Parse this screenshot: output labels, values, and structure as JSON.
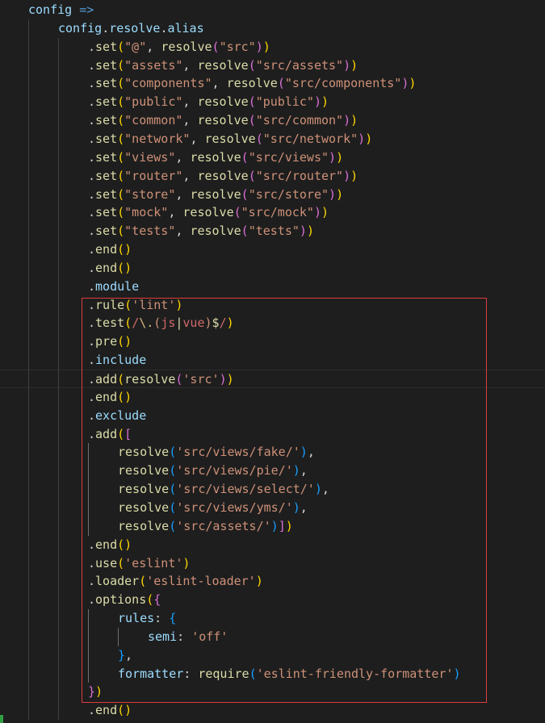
{
  "editor": {
    "lines": [
      {
        "indent": 0,
        "tokens": [
          [
            "config",
            "#9cdcfe"
          ],
          [
            " =>",
            "#569cd6"
          ]
        ]
      },
      {
        "indent": 1,
        "tokens": [
          [
            "config",
            "#9cdcfe"
          ],
          [
            ".",
            "#d4d4d4"
          ],
          [
            "resolve",
            "#9cdcfe"
          ],
          [
            ".",
            "#d4d4d4"
          ],
          [
            "alias",
            "#9cdcfe"
          ]
        ]
      },
      {
        "indent": 2,
        "tokens": [
          [
            ".",
            "#d4d4d4"
          ],
          [
            "set",
            "#dcdcaa"
          ],
          [
            "(",
            "#ffd700"
          ],
          [
            "\"@\"",
            "#ce9178"
          ],
          [
            ", ",
            "#d4d4d4"
          ],
          [
            "resolve",
            "#dcdcaa"
          ],
          [
            "(",
            "#da70d6"
          ],
          [
            "\"src\"",
            "#ce9178"
          ],
          [
            ")",
            "#da70d6"
          ],
          [
            ")",
            "#ffd700"
          ]
        ]
      },
      {
        "indent": 2,
        "tokens": [
          [
            ".",
            "#d4d4d4"
          ],
          [
            "set",
            "#dcdcaa"
          ],
          [
            "(",
            "#ffd700"
          ],
          [
            "\"assets\"",
            "#ce9178"
          ],
          [
            ", ",
            "#d4d4d4"
          ],
          [
            "resolve",
            "#dcdcaa"
          ],
          [
            "(",
            "#da70d6"
          ],
          [
            "\"src/assets\"",
            "#ce9178"
          ],
          [
            ")",
            "#da70d6"
          ],
          [
            ")",
            "#ffd700"
          ]
        ]
      },
      {
        "indent": 2,
        "tokens": [
          [
            ".",
            "#d4d4d4"
          ],
          [
            "set",
            "#dcdcaa"
          ],
          [
            "(",
            "#ffd700"
          ],
          [
            "\"components\"",
            "#ce9178"
          ],
          [
            ", ",
            "#d4d4d4"
          ],
          [
            "resolve",
            "#dcdcaa"
          ],
          [
            "(",
            "#da70d6"
          ],
          [
            "\"src/components\"",
            "#ce9178"
          ],
          [
            ")",
            "#da70d6"
          ],
          [
            ")",
            "#ffd700"
          ]
        ]
      },
      {
        "indent": 2,
        "tokens": [
          [
            ".",
            "#d4d4d4"
          ],
          [
            "set",
            "#dcdcaa"
          ],
          [
            "(",
            "#ffd700"
          ],
          [
            "\"public\"",
            "#ce9178"
          ],
          [
            ", ",
            "#d4d4d4"
          ],
          [
            "resolve",
            "#dcdcaa"
          ],
          [
            "(",
            "#da70d6"
          ],
          [
            "\"public\"",
            "#ce9178"
          ],
          [
            ")",
            "#da70d6"
          ],
          [
            ")",
            "#ffd700"
          ]
        ]
      },
      {
        "indent": 2,
        "tokens": [
          [
            ".",
            "#d4d4d4"
          ],
          [
            "set",
            "#dcdcaa"
          ],
          [
            "(",
            "#ffd700"
          ],
          [
            "\"common\"",
            "#ce9178"
          ],
          [
            ", ",
            "#d4d4d4"
          ],
          [
            "resolve",
            "#dcdcaa"
          ],
          [
            "(",
            "#da70d6"
          ],
          [
            "\"src/common\"",
            "#ce9178"
          ],
          [
            ")",
            "#da70d6"
          ],
          [
            ")",
            "#ffd700"
          ]
        ]
      },
      {
        "indent": 2,
        "tokens": [
          [
            ".",
            "#d4d4d4"
          ],
          [
            "set",
            "#dcdcaa"
          ],
          [
            "(",
            "#ffd700"
          ],
          [
            "\"network\"",
            "#ce9178"
          ],
          [
            ", ",
            "#d4d4d4"
          ],
          [
            "resolve",
            "#dcdcaa"
          ],
          [
            "(",
            "#da70d6"
          ],
          [
            "\"src/network\"",
            "#ce9178"
          ],
          [
            ")",
            "#da70d6"
          ],
          [
            ")",
            "#ffd700"
          ]
        ]
      },
      {
        "indent": 2,
        "tokens": [
          [
            ".",
            "#d4d4d4"
          ],
          [
            "set",
            "#dcdcaa"
          ],
          [
            "(",
            "#ffd700"
          ],
          [
            "\"views\"",
            "#ce9178"
          ],
          [
            ", ",
            "#d4d4d4"
          ],
          [
            "resolve",
            "#dcdcaa"
          ],
          [
            "(",
            "#da70d6"
          ],
          [
            "\"src/views\"",
            "#ce9178"
          ],
          [
            ")",
            "#da70d6"
          ],
          [
            ")",
            "#ffd700"
          ]
        ]
      },
      {
        "indent": 2,
        "tokens": [
          [
            ".",
            "#d4d4d4"
          ],
          [
            "set",
            "#dcdcaa"
          ],
          [
            "(",
            "#ffd700"
          ],
          [
            "\"router\"",
            "#ce9178"
          ],
          [
            ", ",
            "#d4d4d4"
          ],
          [
            "resolve",
            "#dcdcaa"
          ],
          [
            "(",
            "#da70d6"
          ],
          [
            "\"src/router\"",
            "#ce9178"
          ],
          [
            ")",
            "#da70d6"
          ],
          [
            ")",
            "#ffd700"
          ]
        ]
      },
      {
        "indent": 2,
        "tokens": [
          [
            ".",
            "#d4d4d4"
          ],
          [
            "set",
            "#dcdcaa"
          ],
          [
            "(",
            "#ffd700"
          ],
          [
            "\"store\"",
            "#ce9178"
          ],
          [
            ", ",
            "#d4d4d4"
          ],
          [
            "resolve",
            "#dcdcaa"
          ],
          [
            "(",
            "#da70d6"
          ],
          [
            "\"src/store\"",
            "#ce9178"
          ],
          [
            ")",
            "#da70d6"
          ],
          [
            ")",
            "#ffd700"
          ]
        ]
      },
      {
        "indent": 2,
        "tokens": [
          [
            ".",
            "#d4d4d4"
          ],
          [
            "set",
            "#dcdcaa"
          ],
          [
            "(",
            "#ffd700"
          ],
          [
            "\"mock\"",
            "#ce9178"
          ],
          [
            ", ",
            "#d4d4d4"
          ],
          [
            "resolve",
            "#dcdcaa"
          ],
          [
            "(",
            "#da70d6"
          ],
          [
            "\"src/mock\"",
            "#ce9178"
          ],
          [
            ")",
            "#da70d6"
          ],
          [
            ")",
            "#ffd700"
          ]
        ]
      },
      {
        "indent": 2,
        "tokens": [
          [
            ".",
            "#d4d4d4"
          ],
          [
            "set",
            "#dcdcaa"
          ],
          [
            "(",
            "#ffd700"
          ],
          [
            "\"tests\"",
            "#ce9178"
          ],
          [
            ", ",
            "#d4d4d4"
          ],
          [
            "resolve",
            "#dcdcaa"
          ],
          [
            "(",
            "#da70d6"
          ],
          [
            "\"tests\"",
            "#ce9178"
          ],
          [
            ")",
            "#da70d6"
          ],
          [
            ")",
            "#ffd700"
          ]
        ]
      },
      {
        "indent": 2,
        "tokens": [
          [
            ".",
            "#d4d4d4"
          ],
          [
            "end",
            "#dcdcaa"
          ],
          [
            "()",
            "#ffd700"
          ]
        ]
      },
      {
        "indent": 2,
        "tokens": [
          [
            ".",
            "#d4d4d4"
          ],
          [
            "end",
            "#dcdcaa"
          ],
          [
            "()",
            "#ffd700"
          ]
        ]
      },
      {
        "indent": 2,
        "tokens": [
          [
            ".",
            "#d4d4d4"
          ],
          [
            "module",
            "#9cdcfe"
          ]
        ]
      },
      {
        "indent": 2,
        "tokens": [
          [
            ".",
            "#d4d4d4"
          ],
          [
            "rule",
            "#dcdcaa"
          ],
          [
            "(",
            "#ffd700"
          ],
          [
            "'lint'",
            "#ce9178"
          ],
          [
            ")",
            "#ffd700"
          ]
        ]
      },
      {
        "indent": 2,
        "tokens": [
          [
            ".",
            "#d4d4d4"
          ],
          [
            "test",
            "#dcdcaa"
          ],
          [
            "(",
            "#ffd700"
          ],
          [
            "/",
            "#d16969"
          ],
          [
            "\\.",
            "#d7ba7d"
          ],
          [
            "(",
            "#ce9178"
          ],
          [
            "js",
            "#d16969"
          ],
          [
            "|",
            "#dcdcaa"
          ],
          [
            "vue",
            "#d16969"
          ],
          [
            ")",
            "#ce9178"
          ],
          [
            "$",
            "#dcdcaa"
          ],
          [
            "/",
            "#d16969"
          ],
          [
            ")",
            "#ffd700"
          ]
        ]
      },
      {
        "indent": 2,
        "tokens": [
          [
            ".",
            "#d4d4d4"
          ],
          [
            "pre",
            "#dcdcaa"
          ],
          [
            "()",
            "#ffd700"
          ]
        ]
      },
      {
        "indent": 2,
        "tokens": [
          [
            ".",
            "#d4d4d4"
          ],
          [
            "include",
            "#9cdcfe"
          ]
        ]
      },
      {
        "indent": 2,
        "current": true,
        "tokens": [
          [
            ".",
            "#d4d4d4"
          ],
          [
            "add",
            "#dcdcaa"
          ],
          [
            "(",
            "#ffd700"
          ],
          [
            "resolve",
            "#dcdcaa"
          ],
          [
            "(",
            "#da70d6"
          ],
          [
            "'src'",
            "#ce9178"
          ],
          [
            ")",
            "#da70d6"
          ],
          [
            ")",
            "#ffd700"
          ]
        ]
      },
      {
        "indent": 2,
        "tokens": [
          [
            ".",
            "#d4d4d4"
          ],
          [
            "end",
            "#dcdcaa"
          ],
          [
            "()",
            "#ffd700"
          ]
        ]
      },
      {
        "indent": 2,
        "tokens": [
          [
            ".",
            "#d4d4d4"
          ],
          [
            "exclude",
            "#9cdcfe"
          ]
        ]
      },
      {
        "indent": 2,
        "tokens": [
          [
            ".",
            "#d4d4d4"
          ],
          [
            "add",
            "#dcdcaa"
          ],
          [
            "(",
            "#ffd700"
          ],
          [
            "[",
            "#da70d6"
          ]
        ]
      },
      {
        "indent": 3,
        "tokens": [
          [
            "resolve",
            "#dcdcaa"
          ],
          [
            "(",
            "#179fff"
          ],
          [
            "'src/views/fake/'",
            "#ce9178"
          ],
          [
            ")",
            "#179fff"
          ],
          [
            ",",
            "#d4d4d4"
          ]
        ]
      },
      {
        "indent": 3,
        "tokens": [
          [
            "resolve",
            "#dcdcaa"
          ],
          [
            "(",
            "#179fff"
          ],
          [
            "'src/views/pie/'",
            "#ce9178"
          ],
          [
            ")",
            "#179fff"
          ],
          [
            ",",
            "#d4d4d4"
          ]
        ]
      },
      {
        "indent": 3,
        "tokens": [
          [
            "resolve",
            "#dcdcaa"
          ],
          [
            "(",
            "#179fff"
          ],
          [
            "'src/views/select/'",
            "#ce9178"
          ],
          [
            ")",
            "#179fff"
          ],
          [
            ",",
            "#d4d4d4"
          ]
        ]
      },
      {
        "indent": 3,
        "tokens": [
          [
            "resolve",
            "#dcdcaa"
          ],
          [
            "(",
            "#179fff"
          ],
          [
            "'src/views/yms/'",
            "#ce9178"
          ],
          [
            ")",
            "#179fff"
          ],
          [
            ",",
            "#d4d4d4"
          ]
        ]
      },
      {
        "indent": 3,
        "tokens": [
          [
            "resolve",
            "#dcdcaa"
          ],
          [
            "(",
            "#179fff"
          ],
          [
            "'src/assets/'",
            "#ce9178"
          ],
          [
            ")",
            "#179fff"
          ],
          [
            "]",
            "#da70d6"
          ],
          [
            ")",
            "#ffd700"
          ]
        ]
      },
      {
        "indent": 2,
        "tokens": [
          [
            ".",
            "#d4d4d4"
          ],
          [
            "end",
            "#dcdcaa"
          ],
          [
            "()",
            "#ffd700"
          ]
        ]
      },
      {
        "indent": 2,
        "tokens": [
          [
            ".",
            "#d4d4d4"
          ],
          [
            "use",
            "#dcdcaa"
          ],
          [
            "(",
            "#ffd700"
          ],
          [
            "'eslint'",
            "#ce9178"
          ],
          [
            ")",
            "#ffd700"
          ]
        ]
      },
      {
        "indent": 2,
        "tokens": [
          [
            ".",
            "#d4d4d4"
          ],
          [
            "loader",
            "#dcdcaa"
          ],
          [
            "(",
            "#ffd700"
          ],
          [
            "'eslint-loader'",
            "#ce9178"
          ],
          [
            ")",
            "#ffd700"
          ]
        ]
      },
      {
        "indent": 2,
        "tokens": [
          [
            ".",
            "#d4d4d4"
          ],
          [
            "options",
            "#dcdcaa"
          ],
          [
            "(",
            "#ffd700"
          ],
          [
            "{",
            "#da70d6"
          ]
        ]
      },
      {
        "indent": 3,
        "tokens": [
          [
            "rules",
            "#9cdcfe"
          ],
          [
            ": ",
            "#d4d4d4"
          ],
          [
            "{",
            "#179fff"
          ]
        ]
      },
      {
        "indent": 4,
        "tokens": [
          [
            "semi",
            "#9cdcfe"
          ],
          [
            ": ",
            "#d4d4d4"
          ],
          [
            "'off'",
            "#ce9178"
          ]
        ]
      },
      {
        "indent": 3,
        "tokens": [
          [
            "}",
            "#179fff"
          ],
          [
            ",",
            "#d4d4d4"
          ]
        ]
      },
      {
        "indent": 3,
        "tokens": [
          [
            "formatter",
            "#9cdcfe"
          ],
          [
            ": ",
            "#d4d4d4"
          ],
          [
            "require",
            "#dcdcaa"
          ],
          [
            "(",
            "#179fff"
          ],
          [
            "'eslint-friendly-formatter'",
            "#ce9178"
          ],
          [
            ")",
            "#179fff"
          ]
        ]
      },
      {
        "indent": 2,
        "tokens": [
          [
            "}",
            "#da70d6"
          ],
          [
            ")",
            "#ffd700"
          ]
        ]
      },
      {
        "indent": 2,
        "tokens": [
          [
            ".",
            "#d4d4d4"
          ],
          [
            "end",
            "#dcdcaa"
          ],
          [
            "()",
            "#ffd700"
          ]
        ]
      }
    ]
  },
  "colors": {
    "background": "#1e1e1e",
    "highlight_box": "#e03c3c",
    "indent_guide": "#404040",
    "git_added": "#2ea043"
  }
}
